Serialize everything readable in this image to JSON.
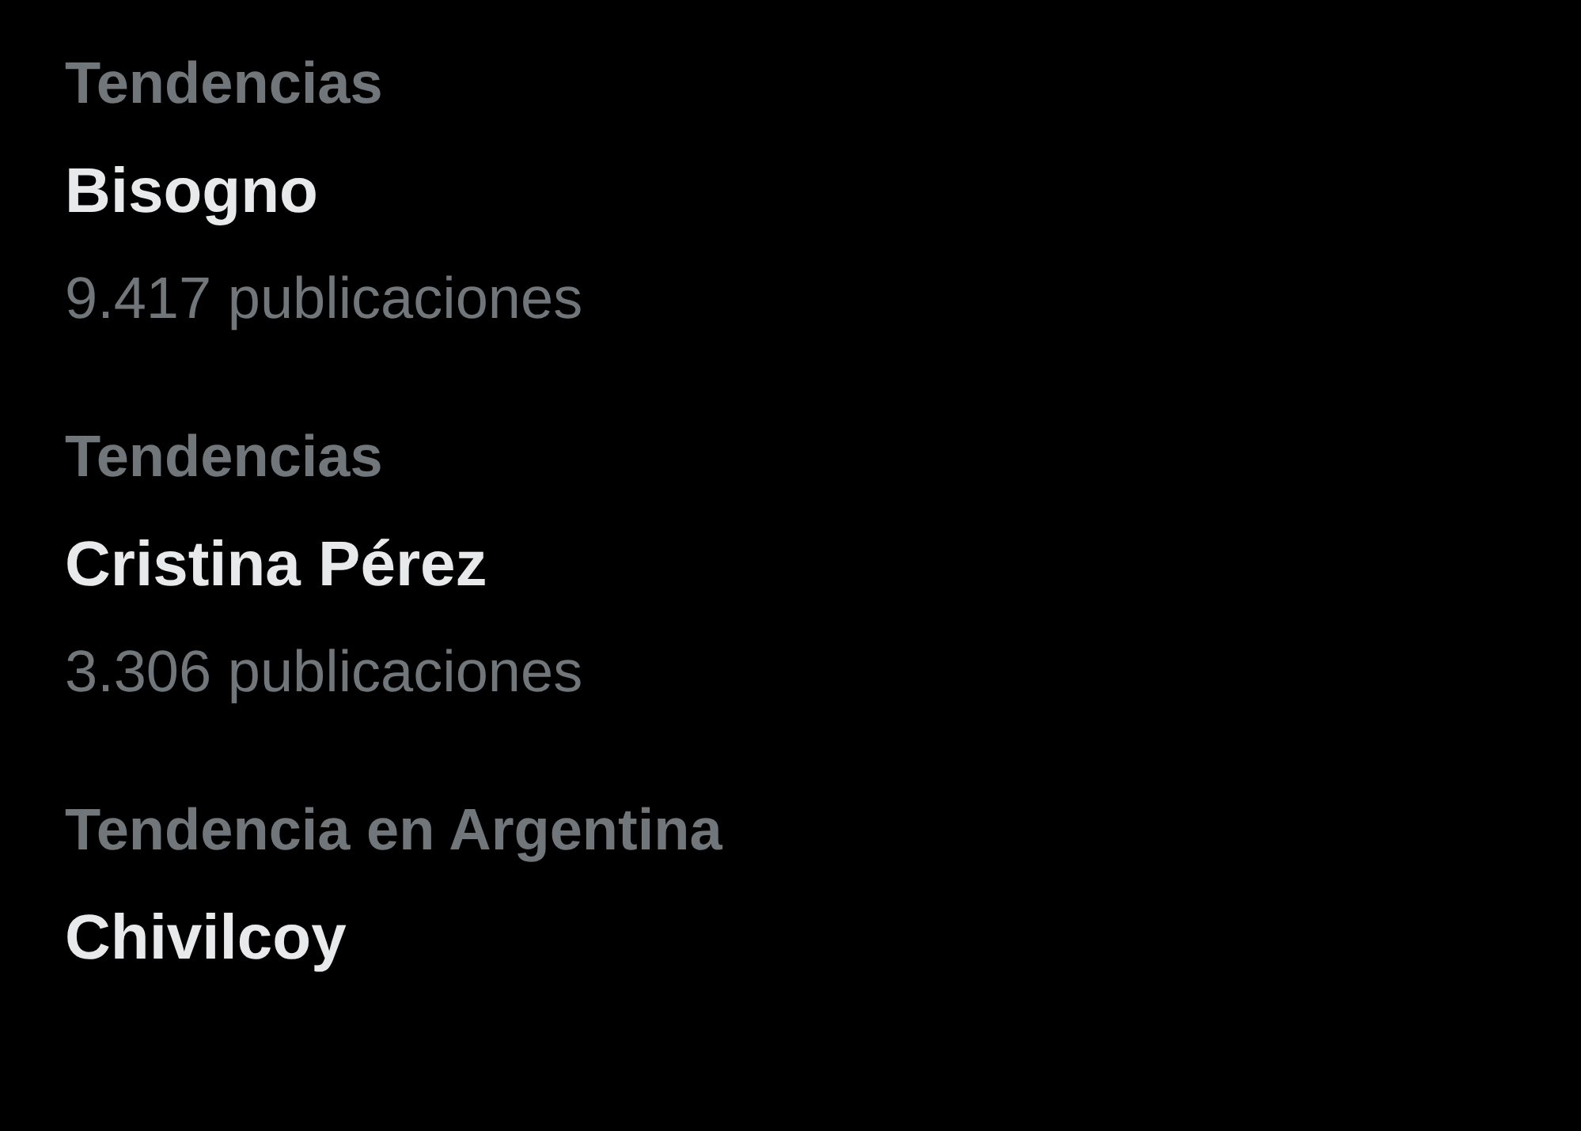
{
  "trends": [
    {
      "context": "Tendencias",
      "name": "Bisogno",
      "count": "9.417 publicaciones"
    },
    {
      "context": "Tendencias",
      "name": "Cristina Pérez",
      "count": "3.306 publicaciones"
    },
    {
      "context": "Tendencia en Argentina",
      "name": "Chivilcoy"
    }
  ]
}
